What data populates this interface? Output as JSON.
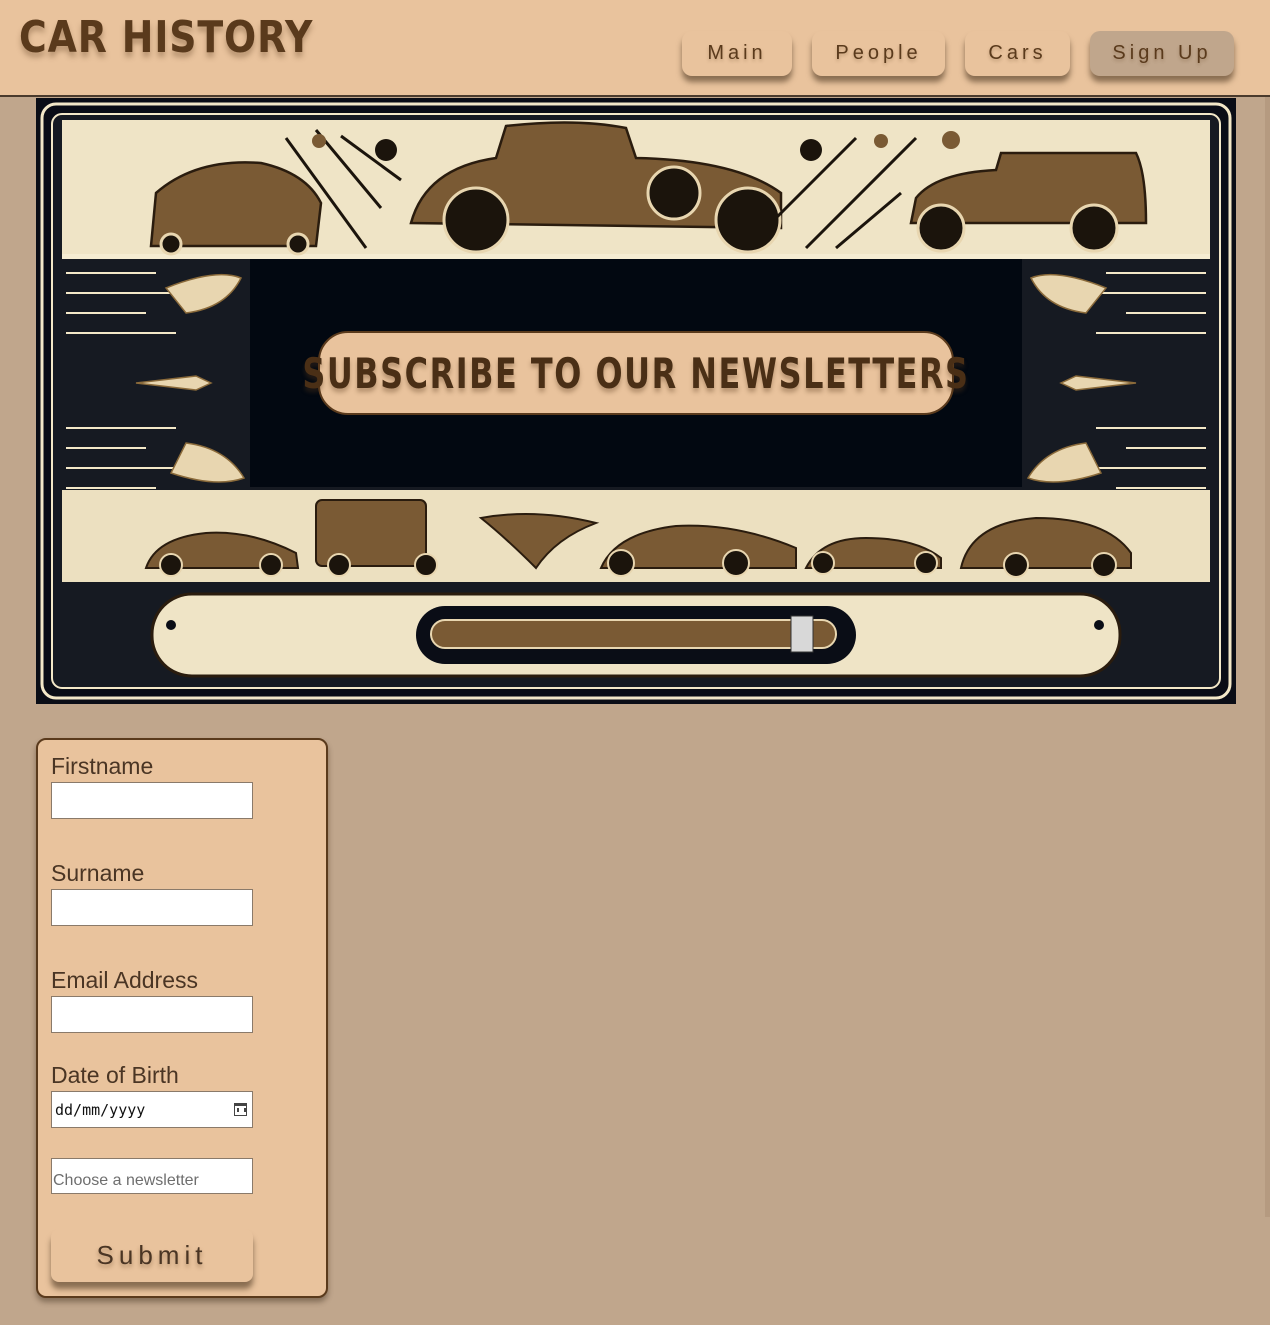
{
  "header": {
    "brand": "CAR HISTORY",
    "nav": [
      {
        "label": "Main",
        "active": false
      },
      {
        "label": "People",
        "active": false
      },
      {
        "label": "Cars",
        "active": false
      },
      {
        "label": "Sign Up",
        "active": true
      }
    ]
  },
  "hero": {
    "banner_text": "SUBSCRIBE TO OUR NEWSLETTERS"
  },
  "form": {
    "firstname_label": "Firstname",
    "firstname_value": "",
    "surname_label": "Surname",
    "surname_value": "",
    "email_label": "Email Address",
    "email_value": "",
    "dob_label": "Date of Birth",
    "dob_placeholder": "dd/mm/yyyy",
    "newsletter_placeholder": "Choose a newsletter",
    "submit_label": "Submit"
  },
  "colors": {
    "page_bg": "#c0a68c",
    "header_bg": "#e9c39d",
    "brand_text": "#5a3a1c",
    "hero_dark": "#020811"
  }
}
